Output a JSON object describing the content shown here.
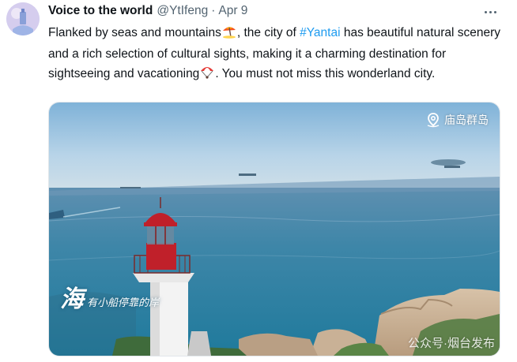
{
  "tweet": {
    "author_name": "Voice to the world",
    "handle": "@YtIfeng",
    "separator": "·",
    "date": "Apr 9",
    "text_part1": "Flanked by seas and mountains",
    "text_part2": ", the city of ",
    "hashtag": "#Yantai",
    "text_part3": " has beautiful natural scenery and a rich selection of cultural sights, making it a charming destination for sightseeing and vacationing",
    "text_part4": ". You must not miss this wonderland city.",
    "emoji1": "beach-umbrella-icon",
    "emoji2": "parachute-icon"
  },
  "media": {
    "location_label": "庙岛群岛",
    "caption_big": "海",
    "caption_small": "有小船停靠的岸",
    "watermark": "公众号·烟台发布"
  },
  "colors": {
    "hashtag": "#1d9bf0",
    "text": "#0f1419",
    "secondary": "#536471"
  }
}
